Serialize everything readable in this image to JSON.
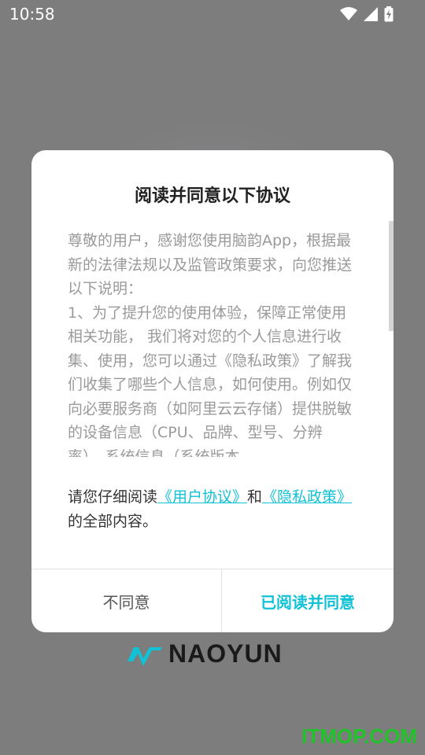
{
  "status_bar": {
    "time": "10:58",
    "icons": [
      "wifi-icon",
      "cellular-signal-icon",
      "battery-charging-icon"
    ]
  },
  "dialog": {
    "title": "阅读并同意以下协议",
    "agreement_text": "尊敬的用户，感谢您使用脑韵App，根据最新的法律法规以及监管政策要求，向您推送以下说明：\n1、为了提升您的使用体验，保障正常使用相关功能， 我们将对您的个人信息进行收集、使用，您可以通过《隐私政策》了解我们收集了哪些个人信息，如何使用。例如仅向必要服务商（如阿里云云存储）提供脱敏的设备信息（CPU、品牌、型号、分辨率），系统信息（系统版本、",
    "notice_prefix": "请您仔细阅读",
    "user_agreement_link": "《用户协议》",
    "notice_and": "和",
    "privacy_policy_link": "《隐私政策》",
    "notice_suffix": "的全部内容。",
    "disagree_label": "不同意",
    "agree_label": "已阅读并同意"
  },
  "brand": {
    "name": "NAOYUN",
    "logo_color": "#11c2d6"
  },
  "watermark": "ITMOP.COM",
  "colors": {
    "accent": "#11c2d6",
    "overlay": "#7d7d7d",
    "watermark": "#22c32a"
  }
}
